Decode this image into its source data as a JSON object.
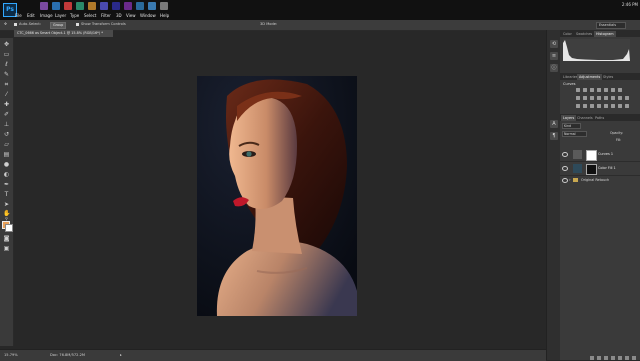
{
  "app": {
    "logo": "Ps"
  },
  "menu": [
    "File",
    "Edit",
    "Image",
    "Layer",
    "Type",
    "Select",
    "Filter",
    "3D",
    "View",
    "Window",
    "Help"
  ],
  "taskbar_colors": [
    "#7a4aa0",
    "#2a6fb0",
    "#c23a3a",
    "#2a8a6a",
    "#b07a2a",
    "#4a4ab0",
    "#2a2a8a",
    "#6a2a8a",
    "#2a6a9a",
    "#3a7ab0",
    "#7a7a7a"
  ],
  "tray": {
    "time": "2:46 PM"
  },
  "options": {
    "auto_select": "Auto-Select:",
    "auto_select_value": "Group",
    "transform_controls": "Show Transform Controls",
    "mode_3d": "3D Mode:",
    "workspace": "Essentials"
  },
  "document": {
    "tab_title": "CTC_0666 as Smart Object-1 @ 15.8% (RGB/16*) *"
  },
  "status": {
    "zoom": "15.79%",
    "doc_size": "Doc: 76.8M/572.2M"
  },
  "panels": {
    "top_tabs": [
      "Color",
      "Swatches",
      "Histogram"
    ],
    "mid_tabs": [
      "Libraries",
      "Adjustments",
      "Styles"
    ],
    "adjustments_title": "Curves",
    "layer_tabs": [
      "Layers",
      "Channels",
      "Paths"
    ],
    "filter_kind": "Kind",
    "blend_mode": "Normal",
    "opacity_label": "Opacity:",
    "fill_label": "Fill:",
    "layers": [
      {
        "name": "Curves 1",
        "thumb": "#ffffff"
      },
      {
        "name": "Color Fill 1",
        "thumb": "#111111"
      }
    ],
    "group": "Original Retouch"
  }
}
